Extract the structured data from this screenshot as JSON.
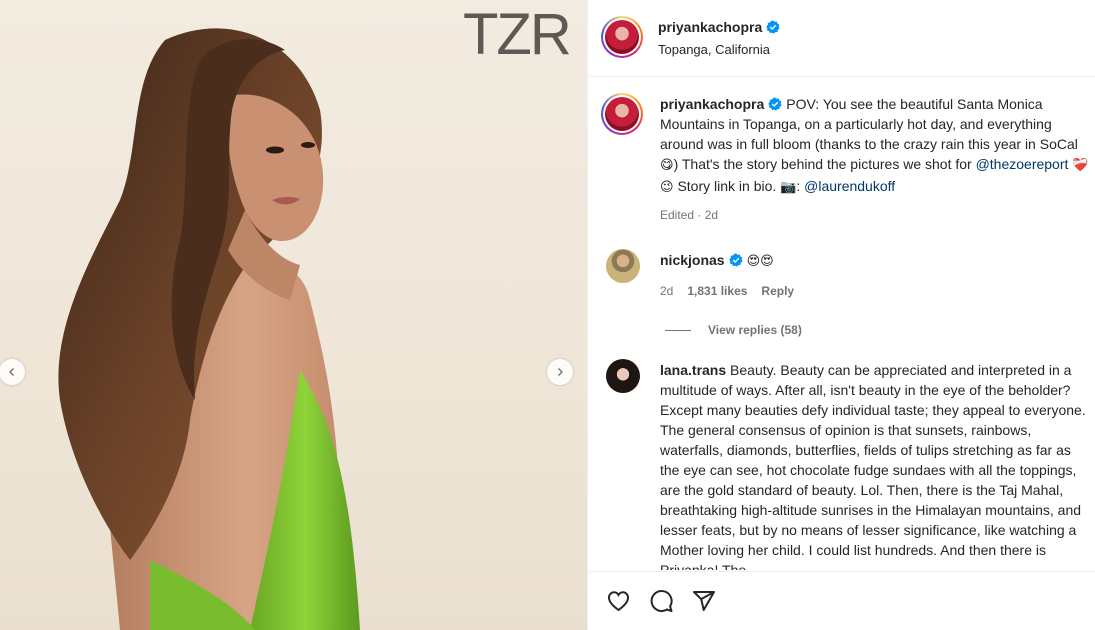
{
  "media": {
    "watermark": "TZR"
  },
  "post": {
    "username": "priyankachopra",
    "location": "Topanga, California"
  },
  "caption": {
    "username": "priyankachopra",
    "text1": "POV: You see the beautiful Santa Monica Mountains in Topanga, on a particularly hot day, and everything around was in full bloom (thanks to the crazy rain this year in SoCal ",
    "emoji1": "😋",
    "text2": ") That's the story behind the pictures we shot for ",
    "mention1": "@thezoereport",
    "emoji2": "❤️‍🩹",
    "emoji3": "😉",
    "text3": " Story link in bio. ",
    "emoji4": "📷",
    "text4": ": ",
    "mention2": "@laurendukoff",
    "edited": "Edited",
    "time": "2d"
  },
  "comments": [
    {
      "username": "nickjonas",
      "text": "😍😍",
      "time": "2d",
      "likes": "1,831 likes",
      "reply_label": "Reply",
      "view_replies": "View replies (58)"
    },
    {
      "username": "lana.trans",
      "text": "Beauty. Beauty can be appreciated and interpreted in a multitude of ways. After all, isn't beauty in the eye of the beholder? Except many beauties defy individual taste; they appeal to everyone. The general consensus of opinion is that sunsets, rainbows, waterfalls, diamonds, butterflies, fields of tulips stretching as far as the eye can see, hot chocolate fudge sundaes with all the toppings, are the gold standard of beauty. Lol. Then, there is the Taj Mahal, breathtaking high-altitude sunrises in the Himalayan mountains, and lesser feats, but by no means of lesser significance, like watching a Mother loving her child. I could list hundreds. And then there is Priyanka! The"
    }
  ],
  "icons": {
    "verified": "verified-badge-icon",
    "like": "heart-icon",
    "comment": "comment-icon",
    "share": "share-icon",
    "prev": "chevron-left-icon",
    "next": "chevron-right-icon"
  },
  "colors": {
    "verified": "#0095f6",
    "mention": "#00376b",
    "dress": "#7cc22e"
  }
}
